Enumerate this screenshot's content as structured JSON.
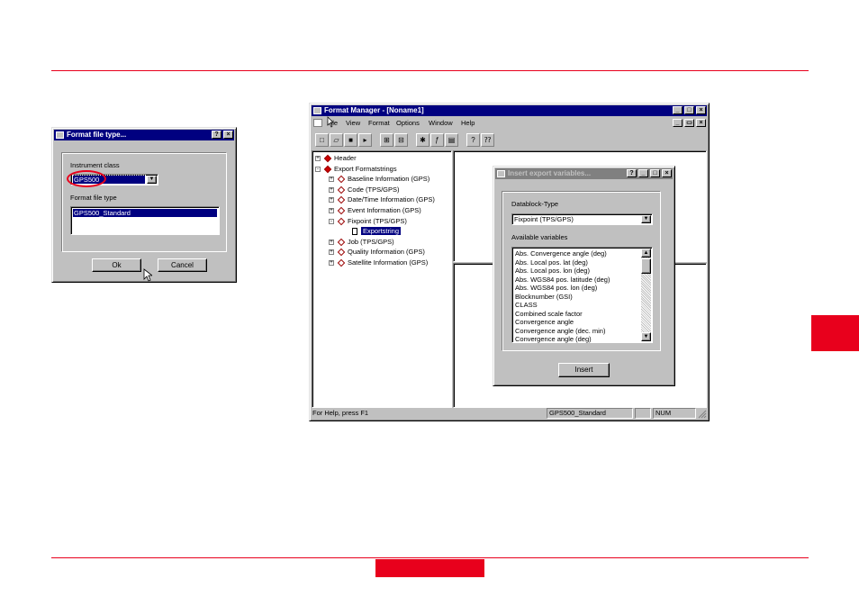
{
  "dialog1": {
    "title": "Format file type...",
    "instrument_class_label": "Instrument class",
    "instrument_class_value": "GPS500",
    "format_file_type_label": "Format file type",
    "format_items": [
      "GPS500_Standard"
    ],
    "ok_label": "Ok",
    "cancel_label": "Cancel"
  },
  "main": {
    "title": "Format Manager - [Noname1]",
    "menu": [
      "File",
      "View",
      "Format",
      "Options",
      "Window",
      "Help"
    ],
    "toolbar_icons": [
      "new-icon",
      "open-icon",
      "save-icon",
      "export-icon",
      "layout-icon",
      "layout2-icon",
      "insert-var-icon",
      "function-icon",
      "properties-icon",
      "help-icon",
      "context-help-icon"
    ],
    "tree": [
      {
        "label": "Header",
        "level": 0,
        "expander": "+",
        "icon": "red"
      },
      {
        "label": "Export Formatstrings",
        "level": 0,
        "expander": "-",
        "icon": "red"
      },
      {
        "label": "Baseline Information (GPS)",
        "level": 1,
        "expander": "+",
        "icon": "white"
      },
      {
        "label": "Code (TPS/GPS)",
        "level": 1,
        "expander": "+",
        "icon": "white"
      },
      {
        "label": "Date/Time Information (GPS)",
        "level": 1,
        "expander": "+",
        "icon": "white"
      },
      {
        "label": "Event Information (GPS)",
        "level": 1,
        "expander": "+",
        "icon": "white"
      },
      {
        "label": "Fixpoint (TPS/GPS)",
        "level": 1,
        "expander": "-",
        "icon": "white"
      },
      {
        "label": "Exportstring",
        "level": 2,
        "expander": "",
        "icon": "doc",
        "selected": true
      },
      {
        "label": "Job (TPS/GPS)",
        "level": 1,
        "expander": "+",
        "icon": "white"
      },
      {
        "label": "Quality Information (GPS)",
        "level": 1,
        "expander": "+",
        "icon": "white"
      },
      {
        "label": "Satellite Information (GPS)",
        "level": 1,
        "expander": "+",
        "icon": "white"
      }
    ],
    "status": {
      "help": "For Help, press F1",
      "format": "GPS500_Standard",
      "num": "NUM"
    }
  },
  "dialog2": {
    "title": "Insert export variables...",
    "datablock_label": "Datablock-Type",
    "datablock_value": "Fixpoint (TPS/GPS)",
    "available_label": "Available variables",
    "variables": [
      "Abs. Convergence angle (deg)",
      "Abs. Local pos. lat (deg)",
      "Abs. Local pos. lon (deg)",
      "Abs. WGS84 pos. latitude (deg)",
      "Abs. WGS84 pos. lon (deg)",
      "Blocknumber (GSI)",
      "CLASS",
      "Combined scale factor",
      "Convergence angle",
      "Convergence angle (dec. min)",
      "Convergence angle (deg)"
    ],
    "insert_label": "Insert"
  },
  "colors": {
    "accent_red": "#e8001c",
    "titlebar": "#000080"
  }
}
